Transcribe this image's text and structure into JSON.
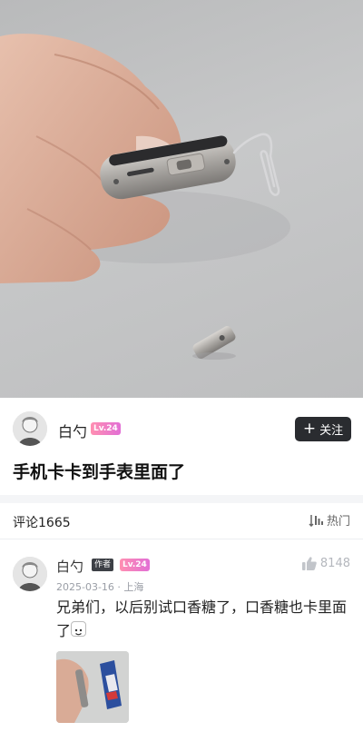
{
  "post": {
    "author": {
      "name": "白勺",
      "level": "Lv.24"
    },
    "follow_label": "关注",
    "title": "手机卡卡到手表里面了"
  },
  "comments_header": {
    "title": "评论1665",
    "sort_label": "热门"
  },
  "comments": [
    {
      "name": "白勺",
      "author_tag": "作者",
      "level": "Lv.24",
      "meta": "2025-03-16 · 上海",
      "likes": "8148",
      "text": "兄弟们，以后别试口香糖了，口香糖也卡里面了"
    }
  ],
  "icons": {
    "follow": "plus-icon",
    "sort": "sort-icon",
    "like": "thumbs-up-icon"
  },
  "colors": {
    "follow_button": "#2a2c30",
    "level_badge": "#e26fd5",
    "author_tag": "#3d4046"
  }
}
